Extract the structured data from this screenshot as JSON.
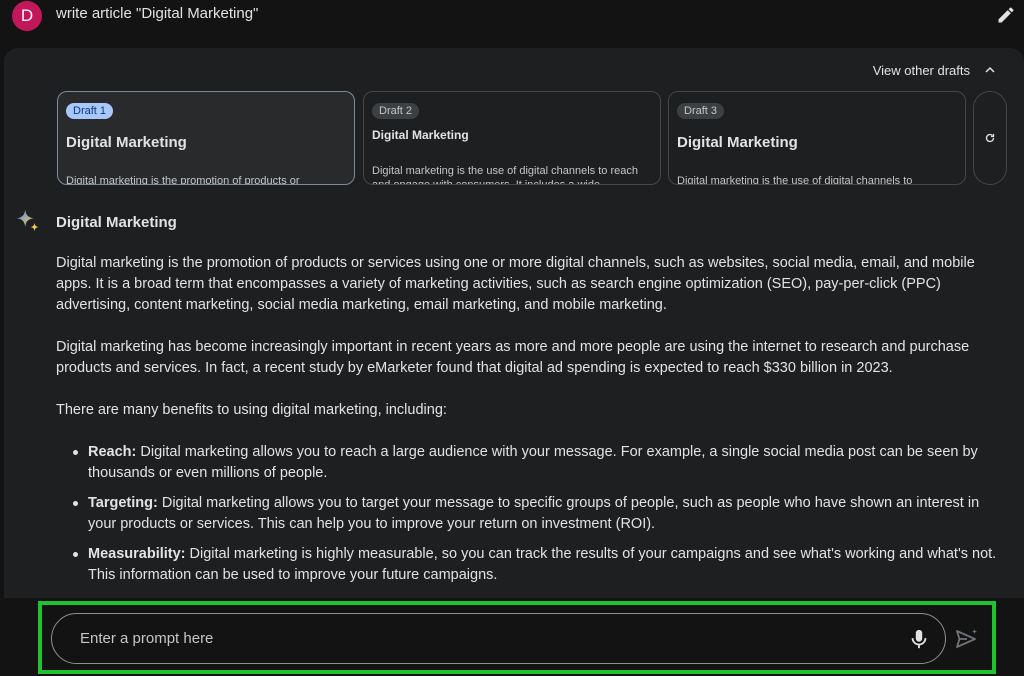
{
  "prompt": {
    "avatar_letter": "D",
    "text": "write article \"Digital Marketing\""
  },
  "drafts_header": {
    "view_label": "View other drafts"
  },
  "drafts": [
    {
      "badge": "Draft 1",
      "title": "Digital Marketing",
      "excerpt": "Digital marketing is the promotion of products or",
      "active": true
    },
    {
      "badge": "Draft 2",
      "title": "Digital Marketing",
      "excerpt": "Digital marketing is the use of digital channels to reach and engage with consumers. It includes a wide",
      "active": false
    },
    {
      "badge": "Draft 3",
      "title": "Digital Marketing",
      "excerpt": "Digital marketing is the use of digital channels to",
      "active": false
    }
  ],
  "response": {
    "heading": "Digital Marketing",
    "p1": "Digital marketing is the promotion of products or services using one or more digital channels, such as websites, social media, email, and mobile apps. It is a broad term that encompasses a variety of marketing activities, such as search engine optimization (SEO), pay-per-click (PPC) advertising, content marketing, social media marketing, email marketing, and mobile marketing.",
    "p2": "Digital marketing has become increasingly important in recent years as more and more people are using the internet to research and purchase products and services. In fact, a recent study by eMarketer found that digital ad spending is expected to reach $330 billion in 2023.",
    "p3": "There are many benefits to using digital marketing, including:",
    "bullets": [
      {
        "label": "Reach:",
        "text": " Digital marketing allows you to reach a large audience with your message. For example, a single social media post can be seen by thousands or even millions of people."
      },
      {
        "label": "Targeting:",
        "text": " Digital marketing allows you to target your message to specific groups of people, such as people who have shown an interest in your products or services. This can help you to improve your return on investment (ROI)."
      },
      {
        "label": "Measurability:",
        "text": " Digital marketing is highly measurable, so you can track the results of your campaigns and see what's working and what's not. This information can be used to improve your future campaigns."
      }
    ]
  },
  "input": {
    "placeholder": "Enter a prompt here"
  },
  "icons": {
    "edit": "pencil-icon",
    "expand": "chevron-up-icon",
    "regenerate": "refresh-icon",
    "assistant": "sparkle-icon",
    "mic": "microphone-icon",
    "send": "send-icon"
  },
  "colors": {
    "highlight": "#21c22f",
    "avatar": "#c2185b",
    "active_badge": "#a8c7fa"
  }
}
